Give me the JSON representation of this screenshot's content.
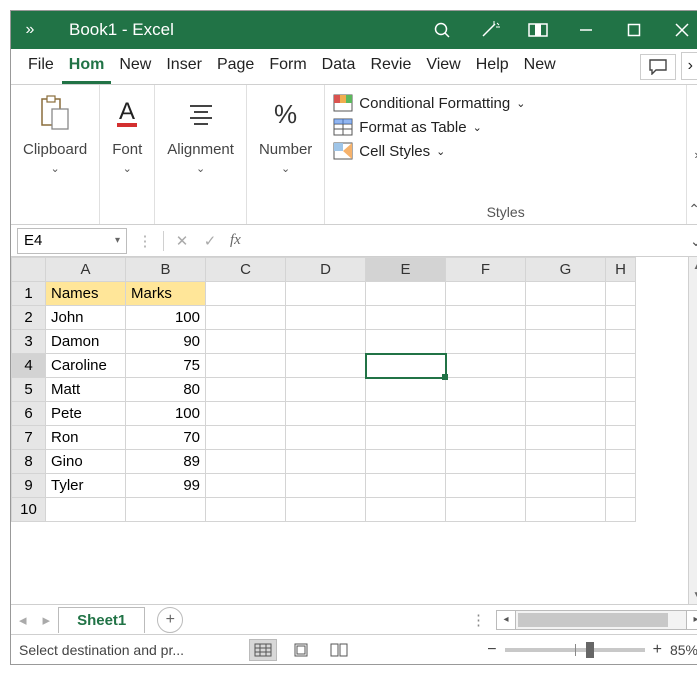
{
  "title": "Book1  -  Excel",
  "tabs": [
    "File",
    "Hom",
    "New",
    "Inser",
    "Page",
    "Form",
    "Data",
    "Revie",
    "View",
    "Help",
    "New"
  ],
  "active_tab_index": 1,
  "ribbon": {
    "clipboard": "Clipboard",
    "font": "Font",
    "alignment": "Alignment",
    "number": "Number",
    "styles_label": "Styles",
    "cond_format": "Conditional Formatting",
    "format_table": "Format as Table",
    "cell_styles": "Cell Styles"
  },
  "namebox": "E4",
  "formula": "",
  "columns": [
    "A",
    "B",
    "C",
    "D",
    "E",
    "F",
    "G",
    "H"
  ],
  "rows": [
    1,
    2,
    3,
    4,
    5,
    6,
    7,
    8,
    9,
    10
  ],
  "selected_cell": {
    "row": 4,
    "col": "E"
  },
  "headers": {
    "A": "Names",
    "B": "Marks"
  },
  "data": [
    {
      "A": "John",
      "B": 100
    },
    {
      "A": "Damon",
      "B": 90
    },
    {
      "A": "Caroline",
      "B": 75
    },
    {
      "A": "Matt",
      "B": 80
    },
    {
      "A": "Pete",
      "B": 100
    },
    {
      "A": "Ron",
      "B": 70
    },
    {
      "A": "Gino",
      "B": 89
    },
    {
      "A": "Tyler",
      "B": 99
    }
  ],
  "sheet": "Sheet1",
  "status_msg": "Select destination and pr...",
  "zoom": "85%"
}
